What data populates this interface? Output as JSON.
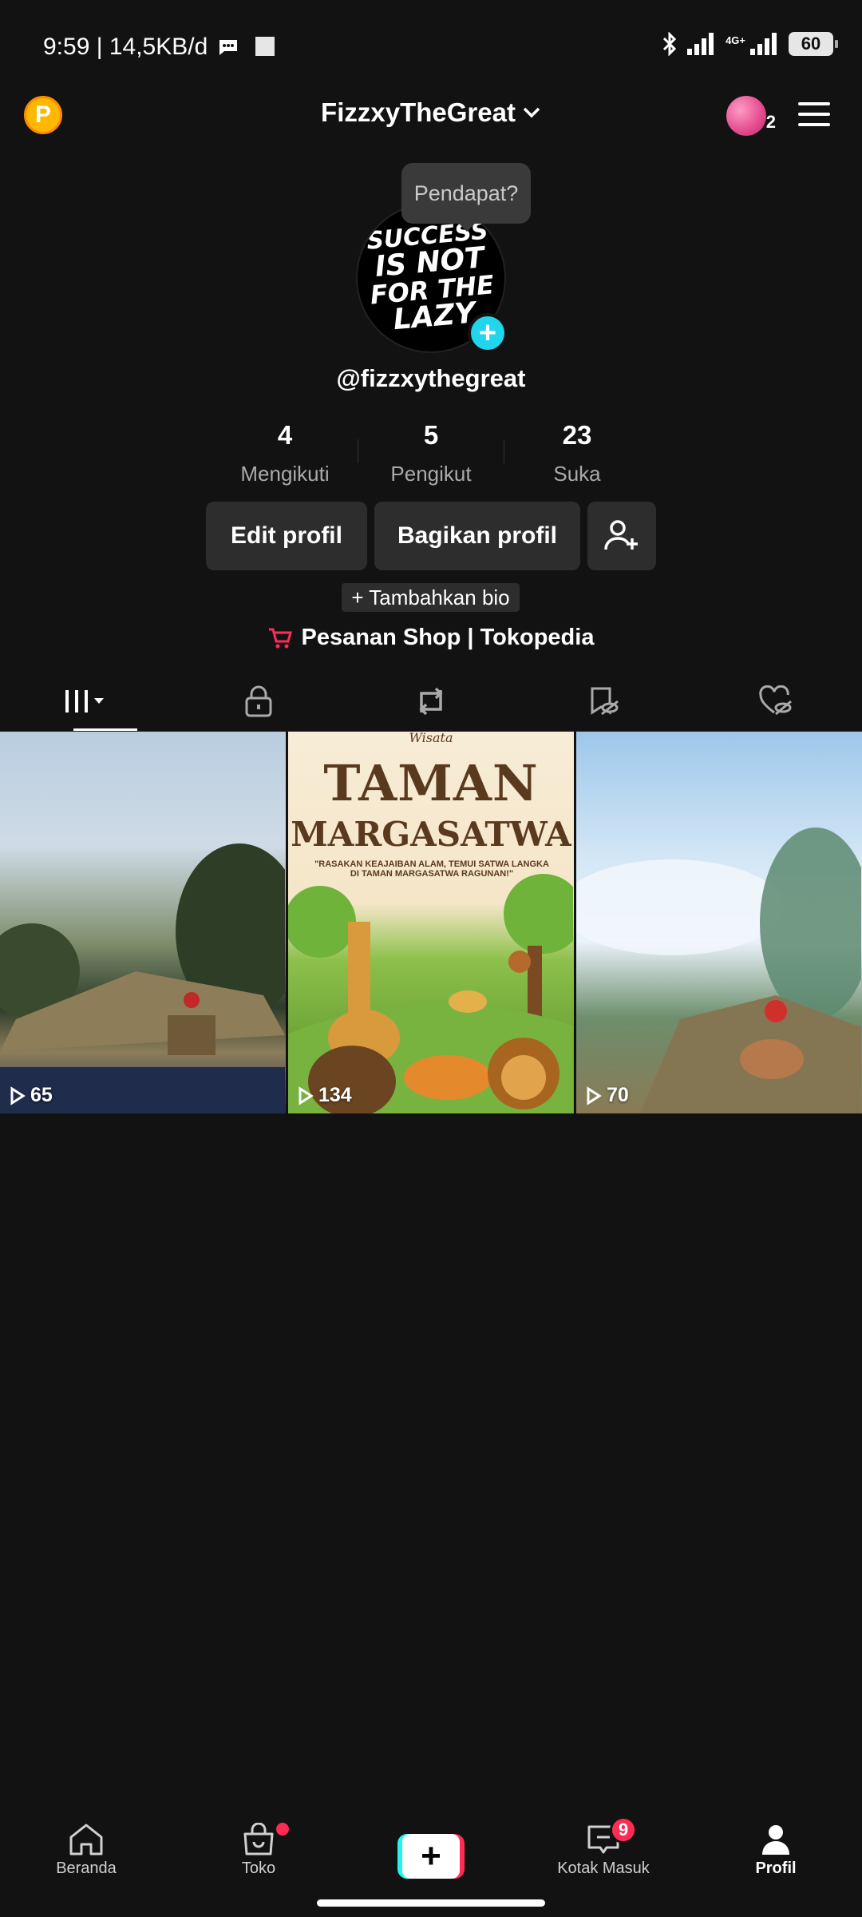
{
  "status": {
    "time": "9:59 | 14,5KB/d",
    "network": "4G+",
    "battery": "60"
  },
  "header": {
    "title": "FizzxyTheGreat",
    "coin_label": "P",
    "friends_count": "2"
  },
  "profile": {
    "tooltip": "Pendapat?",
    "avatar_lines": [
      "SUCCESS",
      "IS NOT",
      "FOR THE",
      "LAZY"
    ],
    "username": "@fizzxythegreat",
    "stats": [
      {
        "value": "4",
        "label": "Mengikuti"
      },
      {
        "value": "5",
        "label": "Pengikut"
      },
      {
        "value": "23",
        "label": "Suka"
      }
    ],
    "edit_label": "Edit profil",
    "share_label": "Bagikan profil",
    "add_bio_label": "+ Tambahkan bio",
    "shop_label": "Pesanan Shop | Tokopedia"
  },
  "tabs": [
    "videos-tab",
    "private-tab",
    "reposts-tab",
    "favorites-tab",
    "liked-tab"
  ],
  "videos": [
    {
      "views": "65",
      "poster": null
    },
    {
      "views": "134",
      "poster": {
        "script": "Wisata",
        "line1": "TAMAN",
        "line2": "MARGASATWA",
        "sub": "\"RASAKAN KEAJAIBAN ALAM, TEMUI SATWA LANGKA DI TAMAN MARGASATWA RAGUNAN!\""
      }
    },
    {
      "views": "70",
      "poster": null
    }
  ],
  "nav": {
    "home": "Beranda",
    "shop": "Toko",
    "inbox": "Kotak Masuk",
    "inbox_badge": "9",
    "profile": "Profil"
  },
  "colors": {
    "background": "#121212",
    "accent_red": "#fe2c55",
    "accent_cyan": "#25f4ee",
    "plus_blue": "#20d5ec",
    "coin": "#ffb800"
  }
}
